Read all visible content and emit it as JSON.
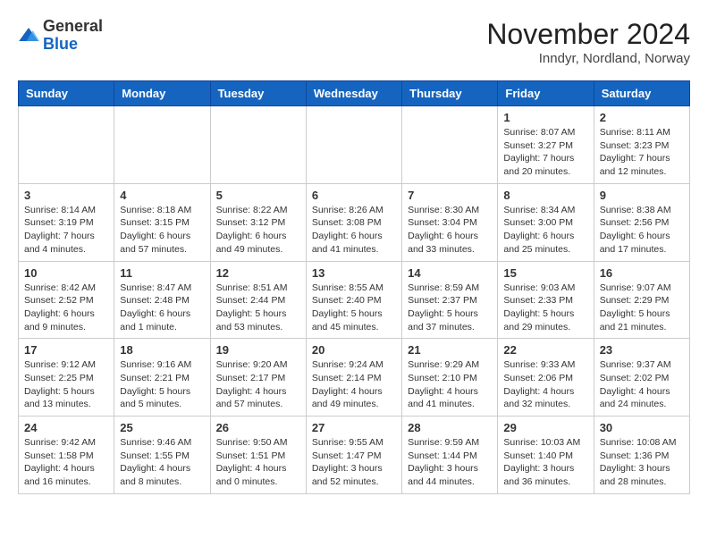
{
  "logo": {
    "general": "General",
    "blue": "Blue"
  },
  "header": {
    "month": "November 2024",
    "location": "Inndyr, Nordland, Norway"
  },
  "weekdays": [
    "Sunday",
    "Monday",
    "Tuesday",
    "Wednesday",
    "Thursday",
    "Friday",
    "Saturday"
  ],
  "weeks": [
    [
      {
        "day": "",
        "info": ""
      },
      {
        "day": "",
        "info": ""
      },
      {
        "day": "",
        "info": ""
      },
      {
        "day": "",
        "info": ""
      },
      {
        "day": "",
        "info": ""
      },
      {
        "day": "1",
        "info": "Sunrise: 8:07 AM\nSunset: 3:27 PM\nDaylight: 7 hours\nand 20 minutes."
      },
      {
        "day": "2",
        "info": "Sunrise: 8:11 AM\nSunset: 3:23 PM\nDaylight: 7 hours\nand 12 minutes."
      }
    ],
    [
      {
        "day": "3",
        "info": "Sunrise: 8:14 AM\nSunset: 3:19 PM\nDaylight: 7 hours\nand 4 minutes."
      },
      {
        "day": "4",
        "info": "Sunrise: 8:18 AM\nSunset: 3:15 PM\nDaylight: 6 hours\nand 57 minutes."
      },
      {
        "day": "5",
        "info": "Sunrise: 8:22 AM\nSunset: 3:12 PM\nDaylight: 6 hours\nand 49 minutes."
      },
      {
        "day": "6",
        "info": "Sunrise: 8:26 AM\nSunset: 3:08 PM\nDaylight: 6 hours\nand 41 minutes."
      },
      {
        "day": "7",
        "info": "Sunrise: 8:30 AM\nSunset: 3:04 PM\nDaylight: 6 hours\nand 33 minutes."
      },
      {
        "day": "8",
        "info": "Sunrise: 8:34 AM\nSunset: 3:00 PM\nDaylight: 6 hours\nand 25 minutes."
      },
      {
        "day": "9",
        "info": "Sunrise: 8:38 AM\nSunset: 2:56 PM\nDaylight: 6 hours\nand 17 minutes."
      }
    ],
    [
      {
        "day": "10",
        "info": "Sunrise: 8:42 AM\nSunset: 2:52 PM\nDaylight: 6 hours\nand 9 minutes."
      },
      {
        "day": "11",
        "info": "Sunrise: 8:47 AM\nSunset: 2:48 PM\nDaylight: 6 hours\nand 1 minute."
      },
      {
        "day": "12",
        "info": "Sunrise: 8:51 AM\nSunset: 2:44 PM\nDaylight: 5 hours\nand 53 minutes."
      },
      {
        "day": "13",
        "info": "Sunrise: 8:55 AM\nSunset: 2:40 PM\nDaylight: 5 hours\nand 45 minutes."
      },
      {
        "day": "14",
        "info": "Sunrise: 8:59 AM\nSunset: 2:37 PM\nDaylight: 5 hours\nand 37 minutes."
      },
      {
        "day": "15",
        "info": "Sunrise: 9:03 AM\nSunset: 2:33 PM\nDaylight: 5 hours\nand 29 minutes."
      },
      {
        "day": "16",
        "info": "Sunrise: 9:07 AM\nSunset: 2:29 PM\nDaylight: 5 hours\nand 21 minutes."
      }
    ],
    [
      {
        "day": "17",
        "info": "Sunrise: 9:12 AM\nSunset: 2:25 PM\nDaylight: 5 hours\nand 13 minutes."
      },
      {
        "day": "18",
        "info": "Sunrise: 9:16 AM\nSunset: 2:21 PM\nDaylight: 5 hours\nand 5 minutes."
      },
      {
        "day": "19",
        "info": "Sunrise: 9:20 AM\nSunset: 2:17 PM\nDaylight: 4 hours\nand 57 minutes."
      },
      {
        "day": "20",
        "info": "Sunrise: 9:24 AM\nSunset: 2:14 PM\nDaylight: 4 hours\nand 49 minutes."
      },
      {
        "day": "21",
        "info": "Sunrise: 9:29 AM\nSunset: 2:10 PM\nDaylight: 4 hours\nand 41 minutes."
      },
      {
        "day": "22",
        "info": "Sunrise: 9:33 AM\nSunset: 2:06 PM\nDaylight: 4 hours\nand 32 minutes."
      },
      {
        "day": "23",
        "info": "Sunrise: 9:37 AM\nSunset: 2:02 PM\nDaylight: 4 hours\nand 24 minutes."
      }
    ],
    [
      {
        "day": "24",
        "info": "Sunrise: 9:42 AM\nSunset: 1:58 PM\nDaylight: 4 hours\nand 16 minutes."
      },
      {
        "day": "25",
        "info": "Sunrise: 9:46 AM\nSunset: 1:55 PM\nDaylight: 4 hours\nand 8 minutes."
      },
      {
        "day": "26",
        "info": "Sunrise: 9:50 AM\nSunset: 1:51 PM\nDaylight: 4 hours\nand 0 minutes."
      },
      {
        "day": "27",
        "info": "Sunrise: 9:55 AM\nSunset: 1:47 PM\nDaylight: 3 hours\nand 52 minutes."
      },
      {
        "day": "28",
        "info": "Sunrise: 9:59 AM\nSunset: 1:44 PM\nDaylight: 3 hours\nand 44 minutes."
      },
      {
        "day": "29",
        "info": "Sunrise: 10:03 AM\nSunset: 1:40 PM\nDaylight: 3 hours\nand 36 minutes."
      },
      {
        "day": "30",
        "info": "Sunrise: 10:08 AM\nSunset: 1:36 PM\nDaylight: 3 hours\nand 28 minutes."
      }
    ]
  ]
}
